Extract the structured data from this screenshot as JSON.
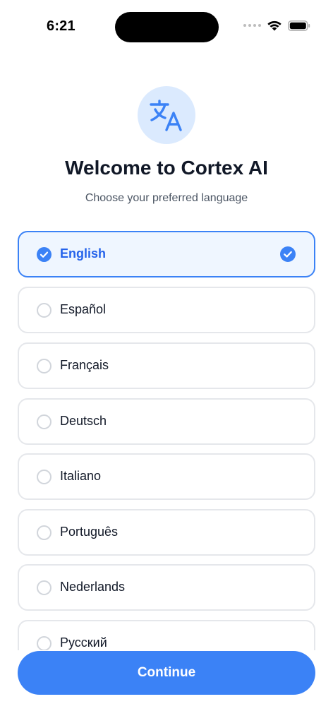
{
  "status_bar": {
    "time": "6:21"
  },
  "header": {
    "icon": "translate-icon",
    "title": "Welcome to Cortex AI",
    "subtitle": "Choose your preferred language"
  },
  "languages": [
    {
      "label": "English",
      "selected": true
    },
    {
      "label": "Español",
      "selected": false
    },
    {
      "label": "Français",
      "selected": false
    },
    {
      "label": "Deutsch",
      "selected": false
    },
    {
      "label": "Italiano",
      "selected": false
    },
    {
      "label": "Português",
      "selected": false
    },
    {
      "label": "Nederlands",
      "selected": false
    },
    {
      "label": "Русский",
      "selected": false
    }
  ],
  "continue_button": {
    "label": "Continue"
  },
  "colors": {
    "accent": "#3b82f6",
    "accent_light": "#eff6ff",
    "icon_bg": "#dbeafe",
    "border": "#e5e7eb"
  }
}
